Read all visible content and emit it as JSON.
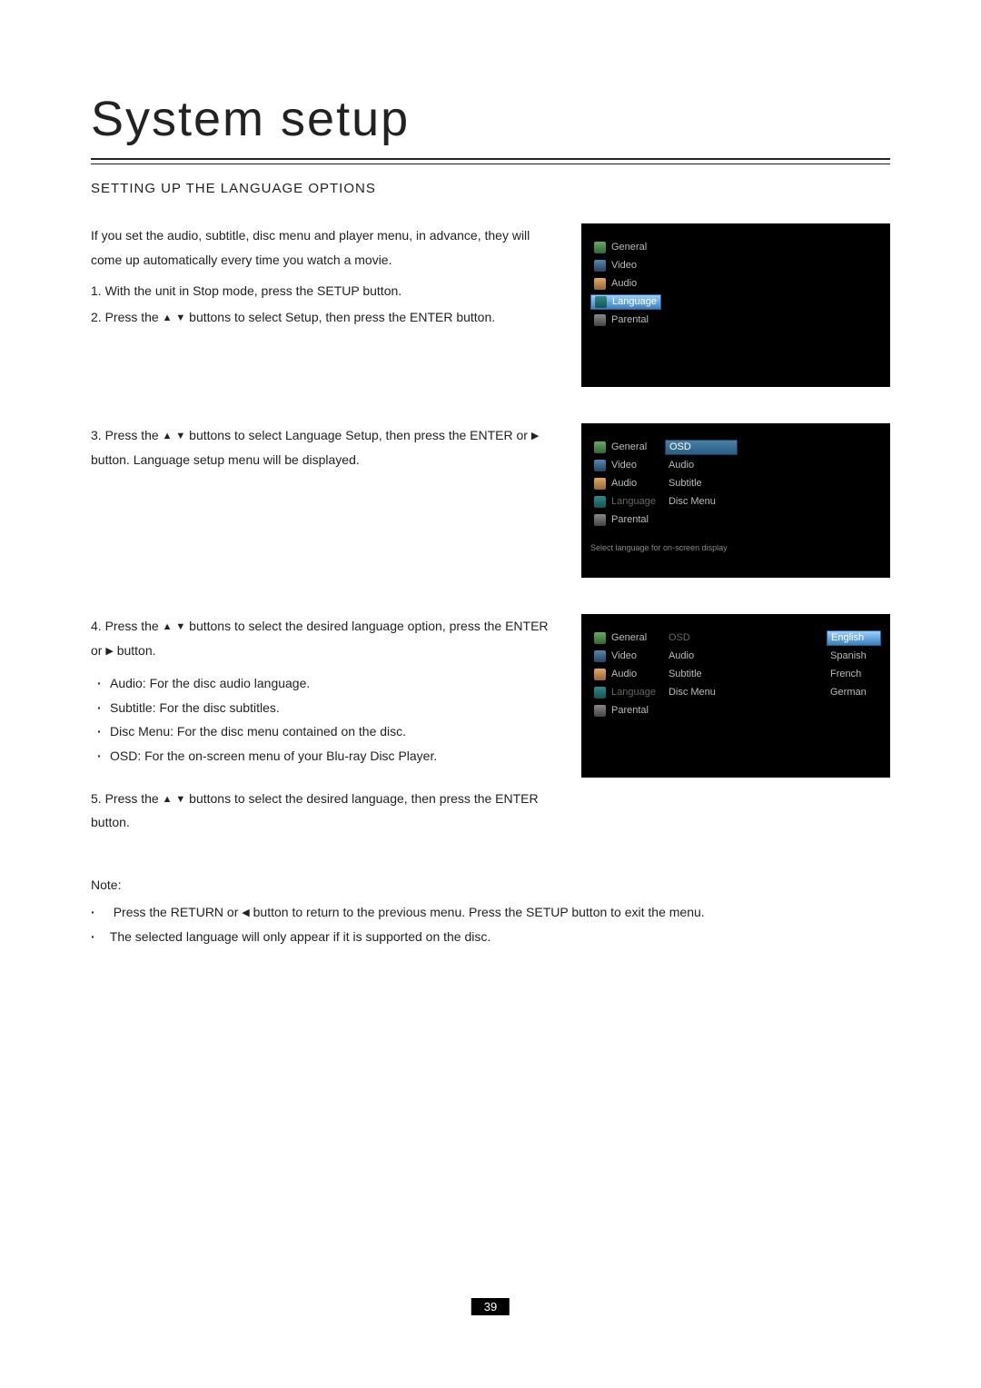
{
  "title": "System setup",
  "section_heading": "SETTING UP THE LANGUAGE OPTIONS",
  "intro": "If you set the audio, subtitle, disc menu and player menu, in advance, they will come up automatically every time you watch a movie.",
  "steps": {
    "s1": "With the unit in Stop mode, press the SETUP button.",
    "s2_a": "Press the ",
    "s2_b": " buttons to select Setup, then press the ENTER button.",
    "s3_a": "Press the ",
    "s3_b": " buttons to select Language Setup, then press the ENTER or ",
    "s3_c": " button. Language setup menu will be displayed.",
    "s4_a": "Press the ",
    "s4_b": " buttons to select the desired language option, press the ENTER or ",
    "s4_c": " button.",
    "s4_opts": {
      "audio": "Audio: For the disc audio language.",
      "subtitle": "Subtitle: For the disc subtitles.",
      "discmenu": "Disc Menu: For the disc menu contained on the disc.",
      "osd": "OSD: For the on-screen menu of your Blu-ray Disc Player."
    },
    "s5_a": "Press the ",
    "s5_b": " buttons to select the desired language, then press the ENTER button."
  },
  "note_label": "Note:",
  "notes": {
    "n1_a": "Press the RETURN or ",
    "n1_b": " button to return to the previous menu. Press the SETUP button to exit the menu.",
    "n2": "The selected language will only appear if it is supported on the disc."
  },
  "osd_menu": {
    "items": [
      "General",
      "Video",
      "Audio",
      "Language",
      "Parental"
    ]
  },
  "osd_sub": {
    "items": [
      "OSD",
      "Audio",
      "Subtitle",
      "Disc Menu"
    ],
    "help": "Select language for on-screen display"
  },
  "osd_lang": {
    "items": [
      "English",
      "Spanish",
      "French",
      "German"
    ]
  },
  "page_number": "39"
}
